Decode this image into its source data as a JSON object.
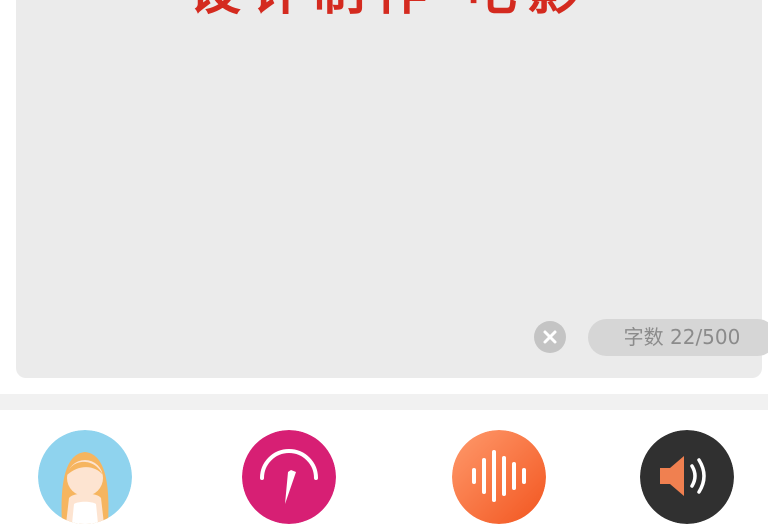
{
  "editor": {
    "text": "设计制作 电影"
  },
  "counter": {
    "label": "字数 22/500"
  },
  "toolbar": {
    "items": [
      {
        "icon": "avatar-icon",
        "color": "#8fd3ee"
      },
      {
        "icon": "speed-gauge-icon",
        "color": "#d71f74"
      },
      {
        "icon": "sound-wave-icon",
        "color": "#ff7a55"
      },
      {
        "icon": "speaker-icon",
        "color": "#303030"
      }
    ]
  },
  "colors": {
    "editor_bg": "#ebebeb",
    "text_red": "#d42a1f",
    "counter_bg": "#d6d6d6"
  }
}
